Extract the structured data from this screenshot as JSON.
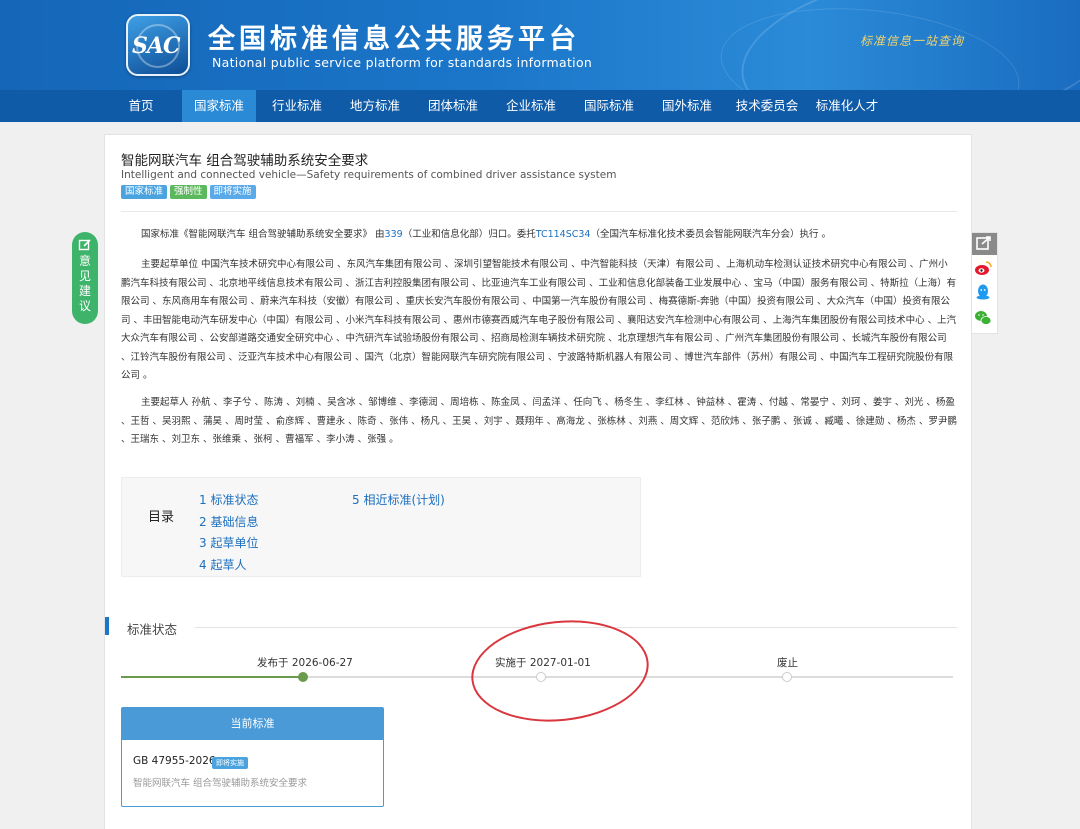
{
  "header": {
    "logo_text": "SAC",
    "site_name_cn": "全国标准信息公共服务平台",
    "site_name_en": "National public service platform  for standards information",
    "slogan": "标准信息一站查询"
  },
  "nav": {
    "items": [
      {
        "label": "首页"
      },
      {
        "label": "国家标准"
      },
      {
        "label": "行业标准"
      },
      {
        "label": "地方标准"
      },
      {
        "label": "团体标准"
      },
      {
        "label": "企业标准"
      },
      {
        "label": "国际标准"
      },
      {
        "label": "国外标准"
      },
      {
        "label": "技术委员会"
      },
      {
        "label": "标准化人才"
      }
    ],
    "active_index": 1
  },
  "standard": {
    "title_cn": "智能网联汽车 组合驾驶辅助系统安全要求",
    "title_en": "Intelligent and connected vehicle—Safety requirements of combined driver assistance system",
    "badges": [
      "国家标准",
      "强制性",
      "即将实施"
    ]
  },
  "intro": {
    "p1_a": "国家标准《智能网联汽车 组合驾驶辅助系统安全要求》 由",
    "p1_link1": "339",
    "p1_b": "（工业和信息化部）归口。委托",
    "p1_link2": "TC114SC34",
    "p1_c": "（全国汽车标准化技术委员会智能网联汽车分会）执行 。"
  },
  "drafting_units": "主要起草单位 中国汽车技术研究中心有限公司 、东风汽车集团有限公司 、深圳引望智能技术有限公司 、中汽智能科技（天津）有限公司 、上海机动车检测认证技术研究中心有限公司 、广州小鹏汽车科技有限公司 、北京地平线信息技术有限公司 、浙江吉利控股集团有限公司 、比亚迪汽车工业有限公司 、工业和信息化部装备工业发展中心 、宝马（中国）服务有限公司 、特斯拉（上海）有限公司 、东风商用车有限公司 、蔚来汽车科技（安徽）有限公司 、重庆长安汽车股份有限公司 、中国第一汽车股份有限公司 、梅赛德斯-奔驰（中国）投资有限公司 、大众汽车（中国）投资有限公司 、丰田智能电动汽车研发中心（中国）有限公司 、小米汽车科技有限公司 、惠州市德赛西威汽车电子股份有限公司 、襄阳达安汽车检测中心有限公司 、上海汽车集团股份有限公司技术中心 、上汽大众汽车有限公司 、公安部道路交通安全研究中心 、中汽研汽车试验场股份有限公司 、招商局检测车辆技术研究院 、北京理想汽车有限公司 、广州汽车集团股份有限公司 、长城汽车股份有限公司 、江铃汽车股份有限公司 、泛亚汽车技术中心有限公司 、国汽（北京）智能网联汽车研究院有限公司 、宁波路特斯机器人有限公司 、博世汽车部件（苏州）有限公司 、中国汽车工程研究院股份有限公司 。",
  "drafters": "主要起草人 孙航 、李子兮 、陈涛 、刘楠 、吴含冰 、邹博维 、李德润 、周培栋 、陈金凤 、闫孟洋 、任向飞 、杨冬生 、李红林 、钟益林 、霍涛 、付越 、常晏宁 、刘珂 、姜宇 、刘光 、杨盈 、王哲 、吴羽熙 、蒲昊 、周时莹 、俞彦辉 、曹建永 、陈奇 、张伟 、杨凡 、王昊 、刘宇 、聂翔年 、高海龙 、张栋林 、刘燕 、周文辉 、范欣炜 、张子鹏 、张诚 、臧曦 、徐建勋 、杨杰 、罗尹鹏 、王瑞东 、刘卫东 、张维乘 、张柯 、曹福军 、李小涛 、张强 。",
  "toc": {
    "title": "目录",
    "items": [
      "1  标准状态",
      "2  基础信息",
      "3  起草单位",
      "4  起草人",
      "5  相近标准(计划)"
    ]
  },
  "status_section": {
    "title": "标准状态",
    "timeline": [
      {
        "label": "发布于 2026-06-27",
        "done": true
      },
      {
        "label": "实施于 2027-01-01",
        "done": false
      },
      {
        "label": "废止",
        "done": false
      }
    ]
  },
  "current": {
    "header": "当前标准",
    "code": "GB 47955-2026",
    "tag": "即将实施",
    "name": "智能网联汽车 组合驾驶辅助系统安全要求"
  },
  "feedback": {
    "label": "意见建议"
  },
  "colors": {
    "header_blue": "#1b76c9",
    "nav_blue": "#0f5ba8",
    "nav_active": "#2a8ad6",
    "done_green": "#6a9a4d",
    "annotation_red": "#d9363e"
  }
}
